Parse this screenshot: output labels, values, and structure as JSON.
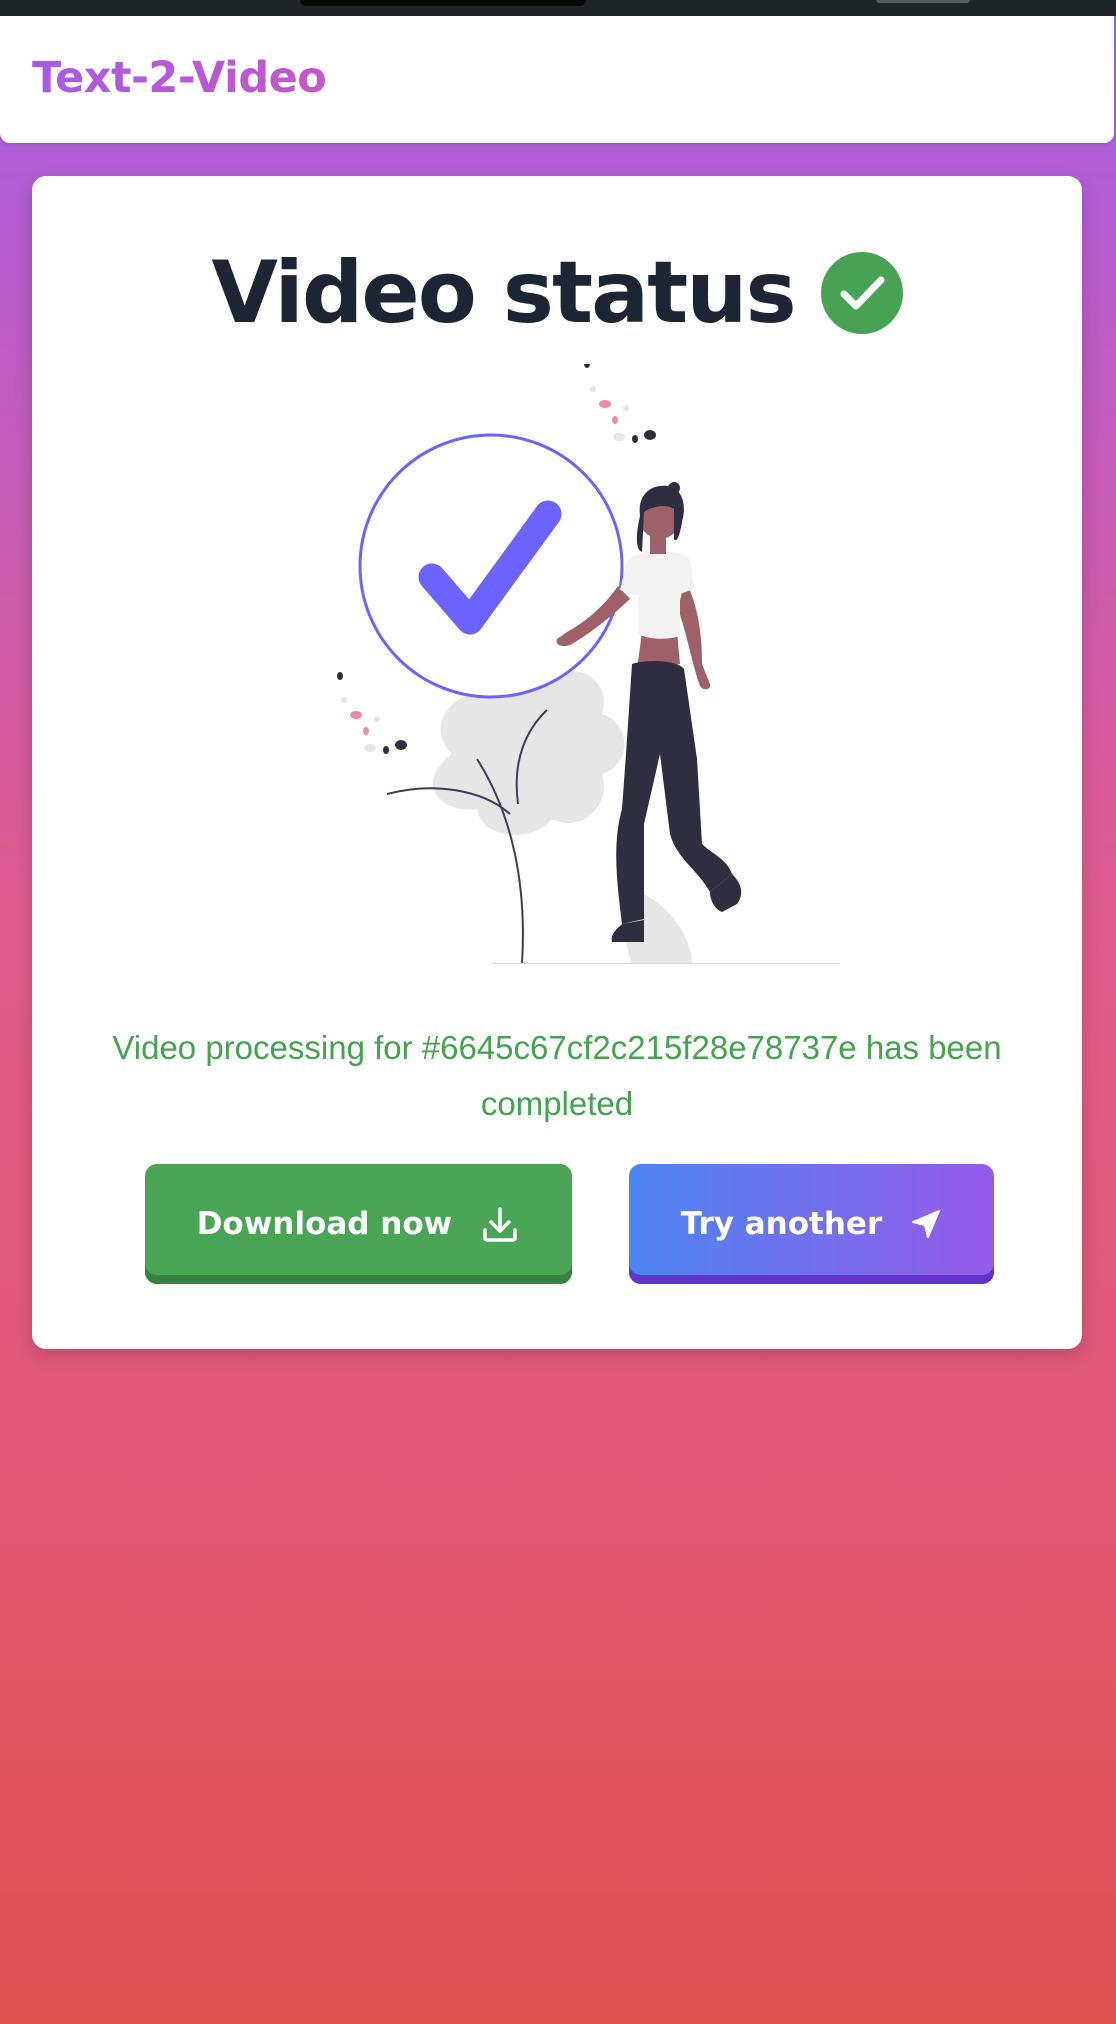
{
  "app": {
    "brand": "Text-2-Video"
  },
  "status": {
    "title": "Video status",
    "message": "Video processing for #6645c67cf2c215f28e78737e has been completed"
  },
  "actions": {
    "download_label": "Download now",
    "try_label": "Try another"
  },
  "icons": {
    "title_status": "check-circle-icon",
    "download": "download-icon",
    "try": "send-arrow-icon"
  },
  "colors": {
    "brand": "#a95ae6",
    "success": "#44a34f",
    "title": "#1d2434",
    "accent_purple": "#6c63ff",
    "gradient_top": "#a85de6",
    "gradient_bottom": "#df5250"
  }
}
